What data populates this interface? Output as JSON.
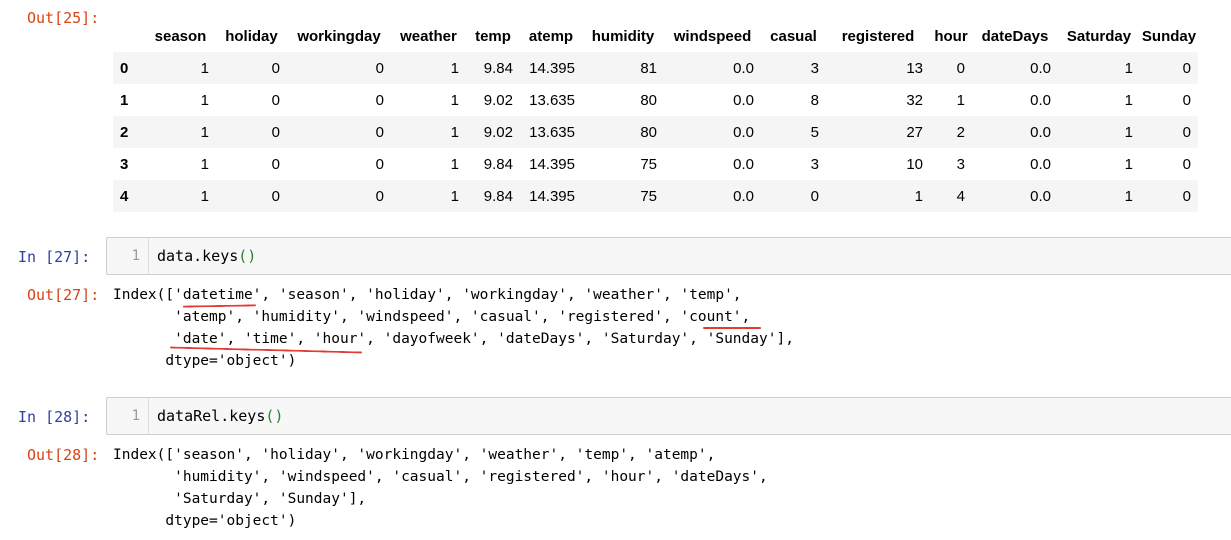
{
  "cell25": {
    "out_prompt": "Out[25]:",
    "columns": [
      "season",
      "holiday",
      "workingday",
      "weather",
      "temp",
      "atemp",
      "humidity",
      "windspeed",
      "casual",
      "registered",
      "hour",
      "dateDays",
      "Saturday",
      "Sunday"
    ],
    "rows": [
      {
        "index": "0",
        "values": [
          "1",
          "0",
          "0",
          "1",
          "9.84",
          "14.395",
          "81",
          "0.0",
          "3",
          "13",
          "0",
          "0.0",
          "1",
          "0"
        ]
      },
      {
        "index": "1",
        "values": [
          "1",
          "0",
          "0",
          "1",
          "9.02",
          "13.635",
          "80",
          "0.0",
          "8",
          "32",
          "1",
          "0.0",
          "1",
          "0"
        ]
      },
      {
        "index": "2",
        "values": [
          "1",
          "0",
          "0",
          "1",
          "9.02",
          "13.635",
          "80",
          "0.0",
          "5",
          "27",
          "2",
          "0.0",
          "1",
          "0"
        ]
      },
      {
        "index": "3",
        "values": [
          "1",
          "0",
          "0",
          "1",
          "9.84",
          "14.395",
          "75",
          "0.0",
          "3",
          "10",
          "3",
          "0.0",
          "1",
          "0"
        ]
      },
      {
        "index": "4",
        "values": [
          "1",
          "0",
          "0",
          "1",
          "9.84",
          "14.395",
          "75",
          "0.0",
          "0",
          "1",
          "4",
          "0.0",
          "1",
          "0"
        ]
      }
    ]
  },
  "cell27": {
    "in_prompt": "In  [27]:",
    "line_number": "1",
    "code": "data.keys",
    "code_parens": "()",
    "out_prompt": "Out[27]:",
    "output": "Index(['datetime', 'season', 'holiday', 'workingday', 'weather', 'temp',\n       'atemp', 'humidity', 'windspeed', 'casual', 'registered', 'count',\n       'date', 'time', 'hour', 'dayofweek', 'dateDays', 'Saturday', 'Sunday'],\n      dtype='object')"
  },
  "cell28": {
    "in_prompt": "In  [28]:",
    "line_number": "1",
    "code": "dataRel.keys",
    "code_parens": "()",
    "out_prompt": "Out[28]:",
    "output": "Index(['season', 'holiday', 'workingday', 'weather', 'temp', 'atemp',\n       'humidity', 'windspeed', 'casual', 'registered', 'hour', 'dateDays',\n       'Saturday', 'Sunday'],\n      dtype='object')"
  },
  "colors": {
    "out_prompt": "#d84315",
    "in_prompt": "#303f9f",
    "annotation_ink": "#e53935"
  }
}
